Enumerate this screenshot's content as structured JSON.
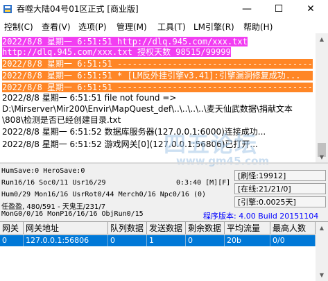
{
  "window": {
    "title": "吞噬大陆04号01区正式 [商业版]",
    "min_glyph": "—",
    "max_glyph": "☐",
    "close_glyph": "✕",
    "icon": "server-app-icon"
  },
  "menu": {
    "items": [
      "控制(C)",
      "查看(V)",
      "选项(P)",
      "管理(M)",
      "工具(T)",
      "LM引擎(R)",
      "帮助(H)"
    ]
  },
  "log": {
    "lines": [
      {
        "text": "2022/8/8 星期一 6:51:51 http://dlq.945.com/xxx.txt",
        "style": "magenta"
      },
      {
        "text": "http://dlq.945.com/xxx.txt 授权天数 98515/99999",
        "style": "magenta"
      },
      {
        "text": "2022/8/8 星期一 6:51:51 -----------------------------------------",
        "style": "orange"
      },
      {
        "text": "2022/8/8 星期一 6:51:51 * [LM反外挂引擎v3.41]:引擎漏洞修复成功...",
        "style": "orange"
      },
      {
        "text": "2022/8/8 星期一 6:51:51 -----------------------------------------",
        "style": "orange"
      },
      {
        "text": "2022/8/8 星期一  6:51:51 file not found => D:\\Mirserver\\Mir200\\Envir\\MapQuest_def\\..\\..\\..\\..\\麦天仙武数据\\捐献文本\\808\\检测是否已经创建目录.txt",
        "style": "wrap"
      },
      {
        "text": "2022/8/8 星期一  6:51:52 数据库服务器(127.0.0.1:6000)连接成功...",
        "style": "normal"
      },
      {
        "text": "2022/8/8 星期一  6:51:52 游戏网关[0](127.0.0.1:56806)已打开...",
        "style": "normal"
      }
    ]
  },
  "watermark": {
    "text": "四五论坛",
    "url": "www.gm45.com"
  },
  "status": {
    "lines": [
      "HumSave:0 HeroSave:0",
      "Run16/16 Soc0/11 Usr16/29",
      "Hum0/29 Mon16/16 UsrRot0/44 Merch0/16 Npc0/16 (0)",
      "任盈盈, 480/591 - 天鬼王/231/7",
      "MonG0/0/16 MonP16/16/16 ObjRun0/15"
    ],
    "time": "0:3:40 [M][F]",
    "refresh": "[刷怪:19912]",
    "online": "[在线:21/21/0]",
    "engine": "[引擎:0.0025天]",
    "version": "程序版本: 4.00 Build 20151104"
  },
  "grid": {
    "headers": [
      "网关",
      "网关地址",
      "队列数据",
      "发送数据",
      "剩余数据",
      "平均流量",
      "最高人数"
    ],
    "rows": [
      [
        "0",
        "127.0.0.1:56806",
        "0",
        "1",
        "0",
        "20b",
        "0/0"
      ]
    ]
  }
}
